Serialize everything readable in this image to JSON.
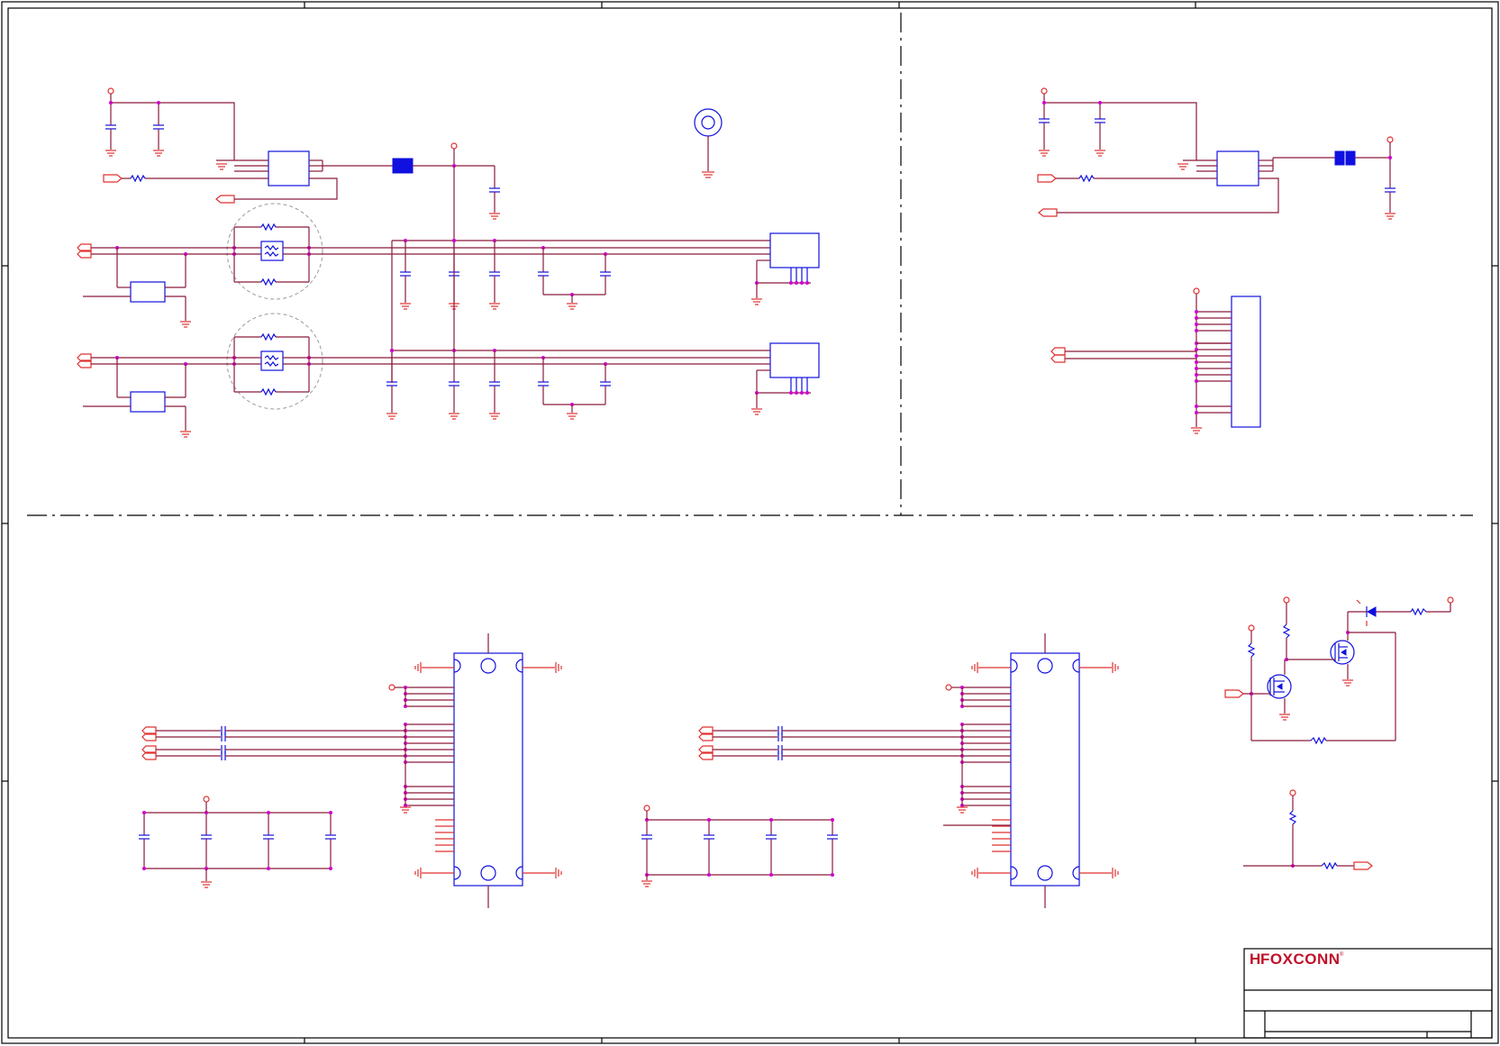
{
  "title_block": {
    "company_logo": "FOXCONN",
    "logo_mark": "H",
    "registered_mark": "®",
    "brand_color": "#c0102a"
  },
  "colors": {
    "wire": "#8b1a3a",
    "symbol_red": "#e03030",
    "symbol_blue": "#1010e0",
    "junction": "#d000d0",
    "border": "#000000"
  },
  "icons": [
    "ground-icon",
    "power-pin-icon",
    "capacitor-icon",
    "resistor-icon",
    "connector-icon",
    "mosfet-icon",
    "led-icon",
    "ic-icon",
    "mounting-hole-icon",
    "common-mode-choke-icon"
  ]
}
